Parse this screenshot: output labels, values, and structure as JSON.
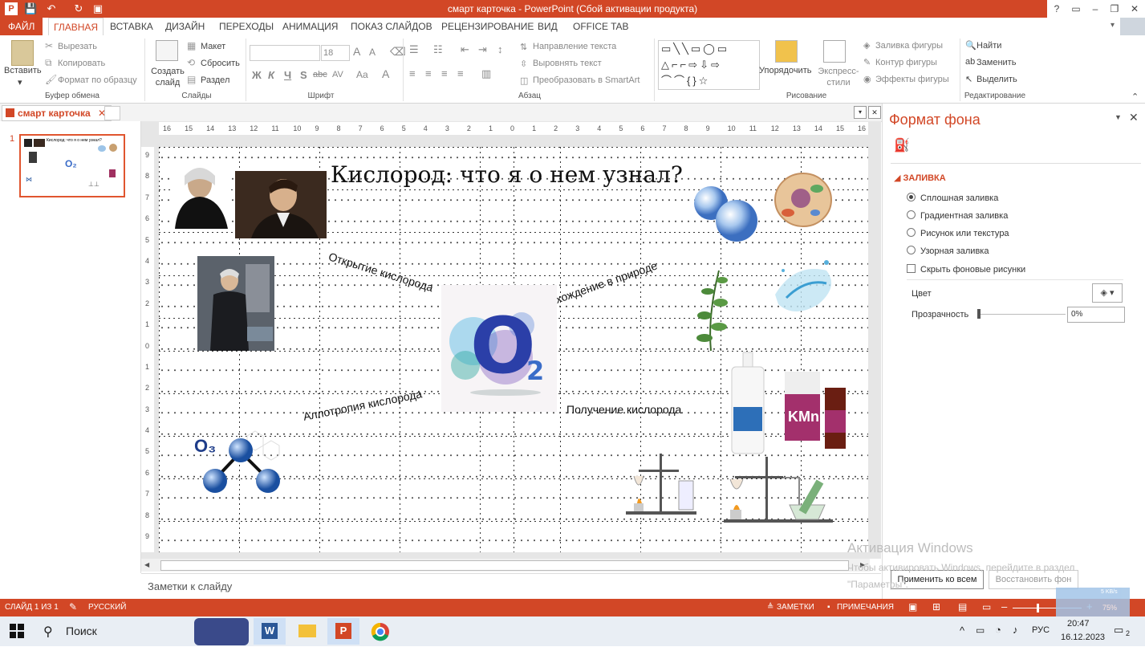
{
  "window": {
    "title": "смарт карточка -  PowerPoint (Сбой активации продукта)",
    "help": "?",
    "minimize": "–",
    "restore": "❐",
    "close": "✕"
  },
  "tabs": [
    "ФАЙЛ",
    "ГЛАВНАЯ",
    "ВСТАВКА",
    "ДИЗАЙН",
    "ПЕРЕХОДЫ",
    "АНИМАЦИЯ",
    "ПОКАЗ СЛАЙДОВ",
    "РЕЦЕНЗИРОВАНИЕ",
    "ВИД",
    "OFFICE TAB"
  ],
  "ribbon": {
    "clipboard": {
      "paste": "Вставить",
      "cut": "Вырезать",
      "copy": "Копировать",
      "format_painter": "Формат по образцу",
      "label": "Буфер обмена"
    },
    "slides": {
      "new_slide": "Создать слайд",
      "layout": "Макет",
      "reset": "Сбросить",
      "section": "Раздел",
      "label": "Слайды"
    },
    "font": {
      "font_size": "18",
      "bold": "Ж",
      "italic": "К",
      "underline": "Ч",
      "shadow": "S",
      "strike": "abc",
      "spacing": "AV",
      "case": "Aa",
      "label": "Шрифт"
    },
    "paragraph": {
      "text_direction": "Направление текста",
      "align_text": "Выровнять текст",
      "smartart": "Преобразовать в SmartArt",
      "label": "Абзац"
    },
    "drawing": {
      "arrange": "Упорядочить",
      "quick_styles": "Экспресс-стили",
      "fill": "Заливка фигуры",
      "outline": "Контур фигуры",
      "effects": "Эффекты фигуры",
      "label": "Рисование"
    },
    "editing": {
      "find": "Найти",
      "replace": "Заменить",
      "select": "Выделить",
      "label": "Редактирование"
    }
  },
  "doc_tab": {
    "name": "смарт карточка"
  },
  "thumbnail": {
    "index": "1",
    "title": "Кислород: что я о нем узнал?"
  },
  "ruler": {
    "h": [
      "16",
      "15",
      "14",
      "13",
      "12",
      "11",
      "10",
      "9",
      "8",
      "7",
      "6",
      "5",
      "4",
      "3",
      "2",
      "1",
      "0",
      "1",
      "2",
      "3",
      "4",
      "5",
      "6",
      "7",
      "8",
      "9",
      "10",
      "11",
      "12",
      "13",
      "14",
      "15",
      "16"
    ],
    "v": [
      "9",
      "8",
      "7",
      "6",
      "5",
      "4",
      "3",
      "2",
      "1",
      "0",
      "1",
      "2",
      "3",
      "4",
      "5",
      "6",
      "7",
      "8",
      "9"
    ]
  },
  "slide": {
    "title": "Кислород: что я о нем узнал?",
    "label_discovery": "Открытие кислорода",
    "label_nature": "Нахождение в природе",
    "label_allotropy": "Аллотропия кислорода",
    "label_obtaining": "Получение кислорода",
    "o2_letter": "O",
    "o2_sub": "2",
    "o3_formula": "O₃",
    "kmno4": "KMn"
  },
  "notes_placeholder": "Заметки к слайду",
  "format_pane": {
    "title": "Формат фона",
    "section": "ЗАЛИВКА",
    "options": [
      "Сплошная заливка",
      "Градиентная заливка",
      "Рисунок или текстура",
      "Узорная заливка"
    ],
    "hide_bg": "Скрыть фоновые рисунки",
    "color_label": "Цвет",
    "transparency_label": "Прозрачность",
    "transparency_value": "0%",
    "apply_all": "Применить ко всем",
    "reset_bg": "Восстановить фон"
  },
  "activation": {
    "title": "Активация Windows",
    "line": "Чтобы активировать Windows, перейдите в раздел \"Параметры\"."
  },
  "status": {
    "slide": "СЛАЙД 1 ИЗ 1",
    "lang": "РУССКИЙ",
    "notes": "ЗАМЕТКИ",
    "comments": "ПРИМЕЧАНИЯ",
    "zoom": "75%",
    "speed": "5 KB/s"
  },
  "taskbar": {
    "search": "Поиск",
    "lang": "РУС",
    "time": "20:47",
    "date": "16.12.2023",
    "notif": "2"
  }
}
